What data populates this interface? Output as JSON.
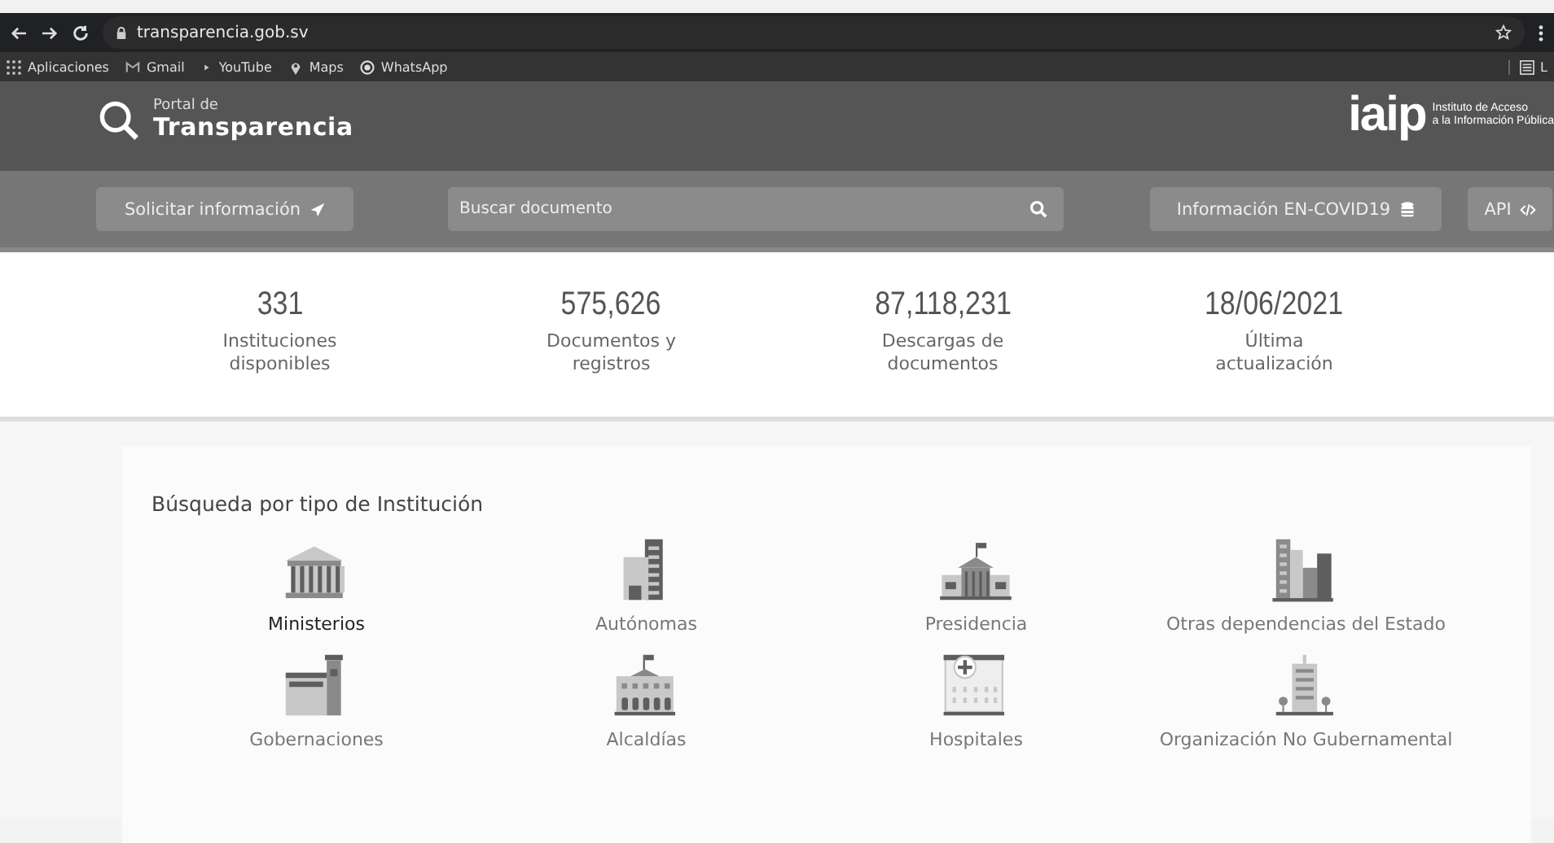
{
  "browser": {
    "url": "transparencia.gob.sv",
    "bookmarks": [
      {
        "kind": "apps",
        "label": "Aplicaciones"
      },
      {
        "kind": "gmail",
        "label": "Gmail"
      },
      {
        "kind": "youtube",
        "label": "YouTube"
      },
      {
        "kind": "maps",
        "label": "Maps"
      },
      {
        "kind": "whatsapp",
        "label": "WhatsApp"
      }
    ],
    "reading_list": "L"
  },
  "header": {
    "logo_small": "Portal de",
    "logo_big": "Transparencia",
    "iaip": "iaip",
    "iaip_line1": "Instituto de Acceso",
    "iaip_line2": "a la Información Pública"
  },
  "nav": {
    "request_button": "Solicitar información",
    "search": {
      "placeholder": "Buscar documento"
    },
    "covid_button": "Información EN-COVID19",
    "api_button": "API"
  },
  "stats": [
    {
      "value": "331",
      "label": "Instituciones disponibles"
    },
    {
      "value": "575,626",
      "label": "Documentos y registros"
    },
    {
      "value": "87,118,231",
      "label": "Descargas de documentos"
    },
    {
      "value": "18/06/2021",
      "label": "Última actualización"
    }
  ],
  "institutions": {
    "title": "Búsqueda por tipo de Institución",
    "items": [
      {
        "kind": "temple",
        "label": "Ministerios",
        "selected": true
      },
      {
        "kind": "tower",
        "label": "Autónomas",
        "selected": false
      },
      {
        "kind": "palace",
        "label": "Presidencia",
        "selected": false
      },
      {
        "kind": "skyline",
        "label": "Otras dependencias del Estado",
        "selected": false
      },
      {
        "kind": "fort",
        "label": "Gobernaciones",
        "selected": false
      },
      {
        "kind": "hall",
        "label": "Alcaldías",
        "selected": false
      },
      {
        "kind": "hospital",
        "label": "Hospitales",
        "selected": false
      },
      {
        "kind": "office",
        "label": "Organización No Gubernamental",
        "selected": false
      }
    ]
  }
}
